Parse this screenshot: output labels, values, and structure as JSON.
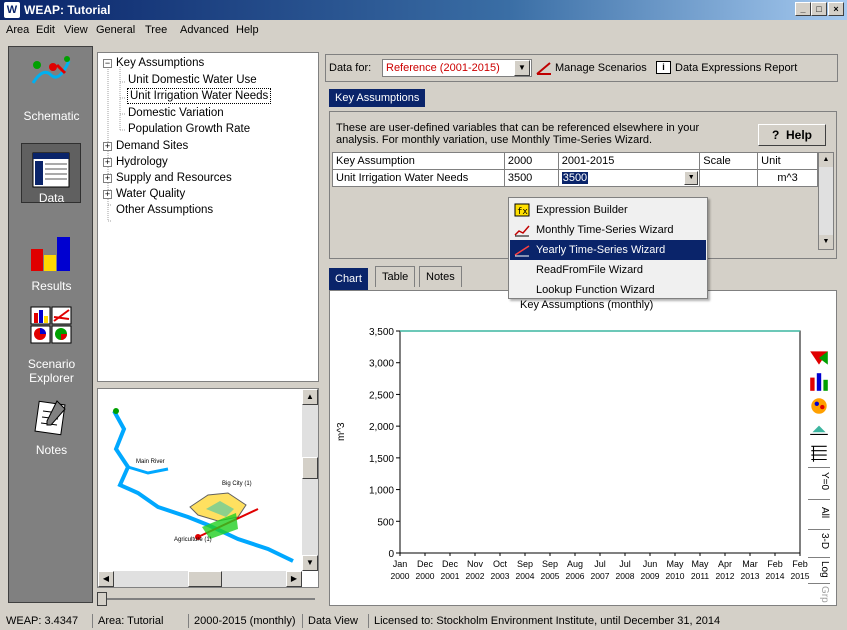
{
  "window": {
    "title": "WEAP: Tutorial",
    "app_icon": "W",
    "min": "_",
    "max": "□",
    "close": "×"
  },
  "menu": [
    "Area",
    "Edit",
    "View",
    "General",
    "Tree",
    "Advanced",
    "Help"
  ],
  "leftbar": [
    {
      "label": "Schematic",
      "icon": "schematic-icon"
    },
    {
      "label": "Data",
      "icon": "data-icon"
    },
    {
      "label": "Results",
      "icon": "results-icon"
    },
    {
      "label": "Scenario\nExplorer",
      "label1": "Scenario",
      "label2": "Explorer",
      "icon": "scenario-explorer-icon"
    },
    {
      "label": "Notes",
      "icon": "notes-icon"
    }
  ],
  "tree": {
    "items": [
      {
        "label": "Key Assumptions",
        "box": "−"
      },
      {
        "label": "Unit Domestic Water Use"
      },
      {
        "label": "Unit Irrigation Water Needs",
        "selected": true
      },
      {
        "label": "Domestic Variation"
      },
      {
        "label": "Population Growth Rate"
      },
      {
        "label": "Demand Sites",
        "box": "+"
      },
      {
        "label": "Hydrology",
        "box": "+"
      },
      {
        "label": "Supply and Resources",
        "box": "+"
      },
      {
        "label": "Water Quality",
        "box": "+"
      },
      {
        "label": "Other Assumptions"
      }
    ]
  },
  "map": {
    "labels": [
      "Main River",
      "Big City (1)",
      "Agriculture (1)"
    ]
  },
  "datafor": {
    "label": "Data for:",
    "scenario": "Reference (2001-2015)",
    "manage": "Manage Scenarios",
    "report": "Data Expressions Report"
  },
  "top_tab": "Key Assumptions",
  "info_text_1": "These are user-defined variables that can be referenced elsewhere in your",
  "info_text_2": "analysis.  For monthly variation, use Monthly Time-Series Wizard.",
  "help_label": "Help",
  "grid": {
    "headers": [
      "Key Assumption",
      "2000",
      "2001-2015",
      "Scale",
      "Unit"
    ],
    "row": [
      "Unit Irrigation Water Needs",
      "3500",
      "3500",
      "",
      "m^3"
    ]
  },
  "context_menu": [
    {
      "label": "Expression Builder",
      "icon": "expression-builder-icon"
    },
    {
      "label": "Monthly Time-Series Wizard",
      "icon": "monthly-wizard-icon"
    },
    {
      "label": "Yearly Time-Series Wizard",
      "icon": "yearly-wizard-icon",
      "selected": true
    },
    {
      "label": "ReadFromFile Wizard"
    },
    {
      "label": "Lookup Function Wizard"
    }
  ],
  "bottom_tabs": [
    "Chart",
    "Table",
    "Notes"
  ],
  "side_tools": [
    "Y=0",
    "All",
    "3-D",
    "Log",
    "Grp",
    "»"
  ],
  "colors": {
    "line": "#3cb5a0",
    "select": "#0a246a",
    "scenario_text": "#cc0000"
  },
  "chart_data": {
    "type": "line",
    "title": "Key Assumptions (monthly)",
    "ylabel": "m^3",
    "xlabel": "",
    "ylim": [
      0,
      3500
    ],
    "yticks": [
      "3,500",
      "3,000",
      "2,500",
      "2,000",
      "1,500",
      "1,000",
      "500",
      "0"
    ],
    "x_months": [
      "Jan",
      "Dec",
      "Dec",
      "Nov",
      "Oct",
      "Sep",
      "Sep",
      "Aug",
      "Jul",
      "Jul",
      "Jun",
      "May",
      "May",
      "Apr",
      "Mar",
      "Feb",
      "Feb"
    ],
    "x_years": [
      "2000",
      "2000",
      "2001",
      "2002",
      "2003",
      "2004",
      "2005",
      "2006",
      "2007",
      "2008",
      "2009",
      "2010",
      "2011",
      "2012",
      "2013",
      "2014",
      "2015"
    ],
    "series": [
      {
        "values": [
          3500,
          3500
        ]
      }
    ]
  },
  "status": [
    "WEAP: 3.4347",
    "Area: Tutorial",
    "2000-2015 (monthly)",
    "Data View",
    "Licensed to: Stockholm Environment Institute, until December 31, 2014"
  ]
}
